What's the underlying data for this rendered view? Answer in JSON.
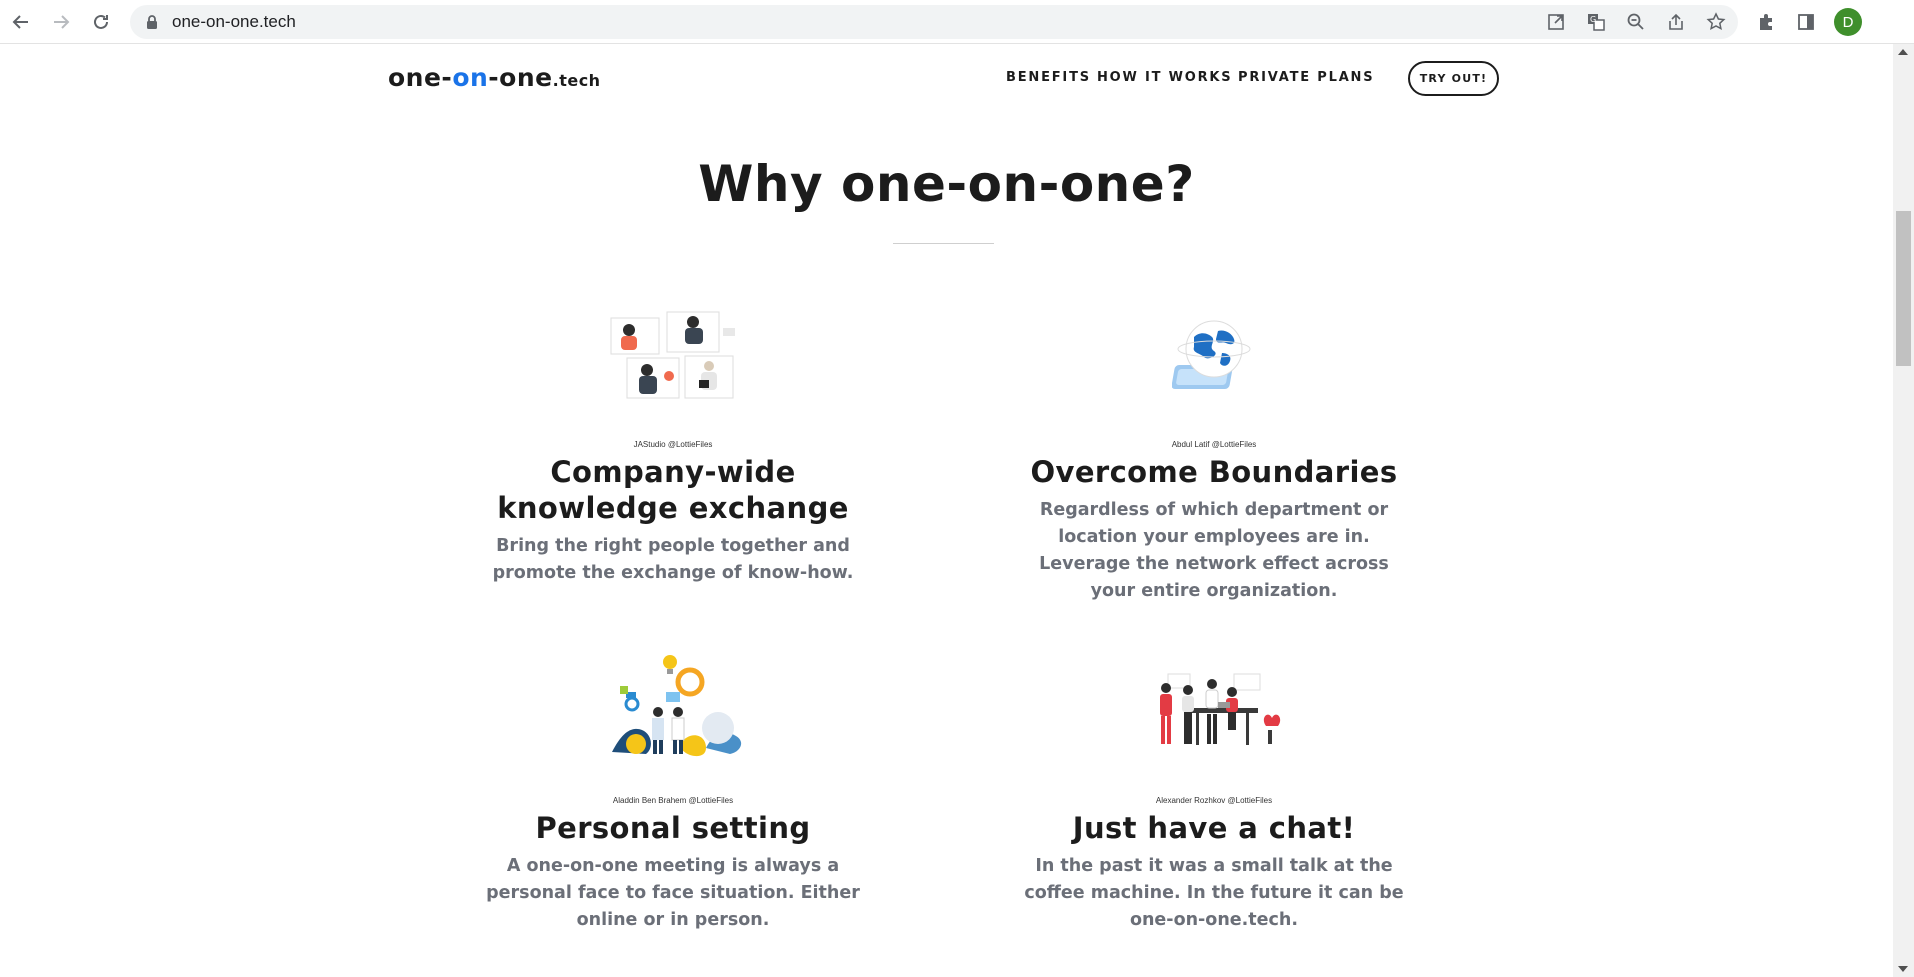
{
  "browser": {
    "url": "one-on-one.tech",
    "avatar_letter": "D"
  },
  "site": {
    "logo": {
      "part1": "one-",
      "part2": "on",
      "part3": "-one",
      "tld": ".tech"
    },
    "nav": [
      "BENEFITS",
      "HOW IT WORKS",
      "PRIVATE PLANS"
    ],
    "cta": "TRY OUT!"
  },
  "section": {
    "title": "Why one-on-one?",
    "cards": [
      {
        "credit": "JAStudio @LottieFiles",
        "title_line1": "Company-wide",
        "title_line2": "knowledge exchange",
        "text_line1": "Bring the right people together and",
        "text_line2": "promote the exchange of know-how."
      },
      {
        "credit": "Abdul Latif @LottieFiles",
        "title_line1": "Overcome Boundaries",
        "text_line1": "Regardless of which department or",
        "text_line2": "location your employees are in.",
        "text_line3": "Leverage the network effect across",
        "text_line4": "your entire organization."
      },
      {
        "credit": "Aladdin Ben Brahem @LottieFiles",
        "title_line1": "Personal setting",
        "text_line1": "A one-on-one meeting is always a",
        "text_line2": "personal face to face situation. Either",
        "text_line3": "online or in person."
      },
      {
        "credit": "Alexander Rozhkov @LottieFiles",
        "title_line1": "Just have a chat!",
        "text_line1": "In the past it was a small talk at the",
        "text_line2": "coffee machine. In the future it can be",
        "text_line3": "one-on-one.tech."
      }
    ]
  },
  "colors": {
    "accent": "#1a73e8",
    "text": "#1c1c1c",
    "muted": "#6b6f78"
  }
}
